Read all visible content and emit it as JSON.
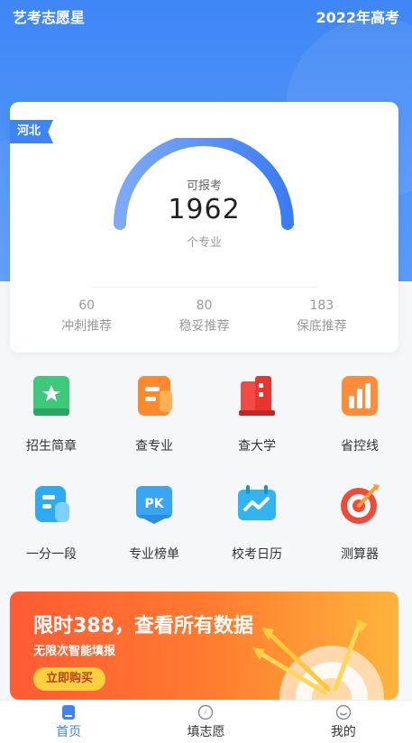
{
  "header": {
    "app_name": "艺考志愿星",
    "year_label": "2022年高考"
  },
  "summary": {
    "province": "河北",
    "gauge_label": "可报考",
    "gauge_value": "1962",
    "gauge_unit": "个专业",
    "stats": [
      {
        "value": "60",
        "label": "冲刺推荐"
      },
      {
        "value": "80",
        "label": "稳妥推荐"
      },
      {
        "value": "183",
        "label": "保底推荐"
      }
    ]
  },
  "features": [
    {
      "label": "招生简章",
      "icon": "book-icon"
    },
    {
      "label": "查专业",
      "icon": "document-icon"
    },
    {
      "label": "查大学",
      "icon": "building-icon"
    },
    {
      "label": "省控线",
      "icon": "bar-chart-icon"
    },
    {
      "label": "一分一段",
      "icon": "list-icon"
    },
    {
      "label": "专业榜单",
      "icon": "pk-icon"
    },
    {
      "label": "校考日历",
      "icon": "calendar-icon"
    },
    {
      "label": "测算器",
      "icon": "target-icon"
    }
  ],
  "banner": {
    "title": "限时388，查看所有数据",
    "subtitle": "无限次智能填报",
    "button": "立即购买"
  },
  "tabbar": {
    "items": [
      {
        "label": "首页",
        "icon": "home-icon",
        "active": true
      },
      {
        "label": "填志愿",
        "icon": "compass-icon",
        "active": false
      },
      {
        "label": "我的",
        "icon": "smile-icon",
        "active": false
      }
    ]
  },
  "colors": {
    "primary": "#3f84f5",
    "banner_start": "#ff5b34",
    "banner_end": "#ffb43c"
  }
}
